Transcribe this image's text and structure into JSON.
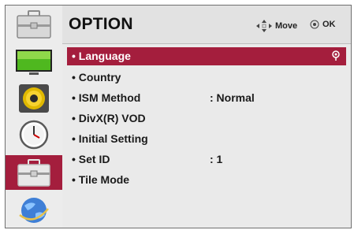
{
  "header": {
    "title": "OPTION",
    "move_hint": "Move",
    "ok_hint": "OK"
  },
  "sidebar": {
    "items": [
      {
        "name": "option-toolbox",
        "icon": "toolbox-icon"
      },
      {
        "name": "picture",
        "icon": "tv-screen-icon"
      },
      {
        "name": "audio",
        "icon": "speaker-icon"
      },
      {
        "name": "time",
        "icon": "clock-icon"
      },
      {
        "name": "option",
        "icon": "toolbox-icon",
        "active": true
      },
      {
        "name": "network",
        "icon": "globe-icon"
      }
    ]
  },
  "menu": {
    "items": [
      {
        "label": "• Language",
        "value": "",
        "selected": true
      },
      {
        "label": "• Country",
        "value": ""
      },
      {
        "label": "• ISM Method",
        "value": ": Normal"
      },
      {
        "label": "• DivX(R) VOD",
        "value": ""
      },
      {
        "label": "• Initial Setting",
        "value": ""
      },
      {
        "label": "• Set ID",
        "value": ": 1"
      },
      {
        "label": "• Tile Mode",
        "value": ""
      }
    ]
  },
  "colors": {
    "accent": "#a41e3d",
    "panel": "#eaeaea",
    "header": "#e2e2e2"
  }
}
